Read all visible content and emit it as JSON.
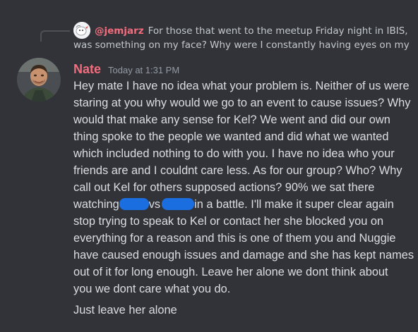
{
  "reply": {
    "author": "@jemjarz",
    "text": "For those that went to the meetup Friday night in IBIS, was something on my face? Why were I constantly having eyes on my"
  },
  "message": {
    "author": "Nate",
    "timestamp": "Today at 1:31 PM",
    "lines": [
      "Hey mate I have no idea what your problem is. Neither of us were",
      "staring at you why would we go to an event to cause issues? Why",
      "would that make any sense for Kel? We went and did our own",
      "thing spoke to the people we wanted and did what we wanted",
      "which included nothing to do with you. I have no idea who your",
      "friends are and I couldnt care less. As for our group? Who? Why",
      "call out Kel for others supposed actions? 90% we sat there"
    ],
    "redacted_line": {
      "part1": "watching",
      "part2": "vs",
      "part3": "in a battle. I'll make it super clear again"
    },
    "lines_after": [
      "stop trying to speak to Kel or contact her she blocked you on",
      "everything for a reason and this is one of them you and Nuggie",
      "have caused enough issues and damage and she has kept names",
      "out of it for long enough. Leave her alone we dont think about",
      "you we dont care what you do."
    ],
    "followup": "Just leave her alone"
  },
  "colors": {
    "background": "#313338",
    "author": "#f26d7d",
    "text": "#dbdee1",
    "timestamp": "#949ba4",
    "redaction": "#1b6ee0"
  }
}
